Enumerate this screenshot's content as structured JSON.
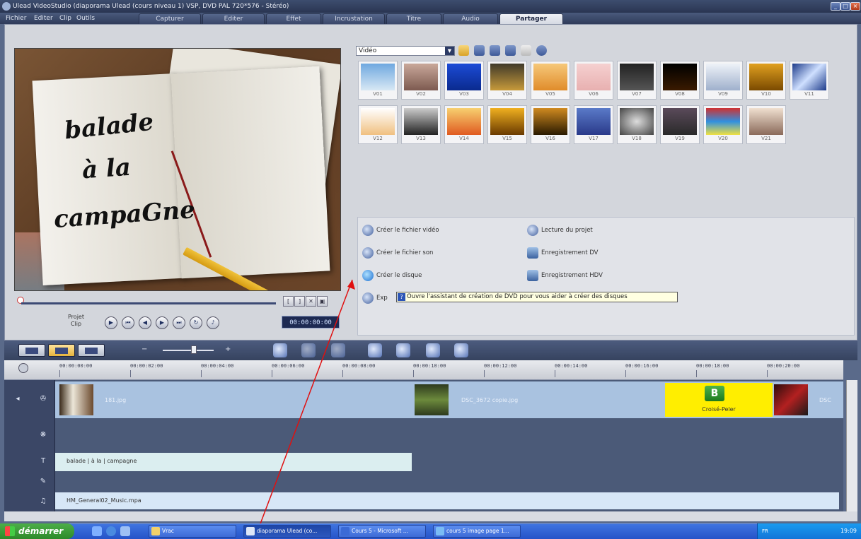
{
  "window": {
    "title": "Ulead VideoStudio (diaporama Ulead (cours niveau 1) VSP, DVD PAL 720*576 - Stéréo)"
  },
  "menu": [
    "Fichier",
    "Editer",
    "Clip",
    "Outils"
  ],
  "tabs": [
    "Capturer",
    "Editer",
    "Effet",
    "Incrustation",
    "Titre",
    "Audio",
    "Partager"
  ],
  "active_tab": "Partager",
  "preview": {
    "handwritten_text": [
      "balade",
      "à la",
      "campaGne"
    ],
    "mode_label_top": "Projet",
    "mode_label_bottom": "Clip",
    "timecode": "00:00:00:00"
  },
  "library": {
    "category": "Vidéo",
    "thumbnails": [
      "V01",
      "V02",
      "V03",
      "V04",
      "V05",
      "V06",
      "V07",
      "V08",
      "V09",
      "V10",
      "V11",
      "V12",
      "V13",
      "V14",
      "V15",
      "V16",
      "V17",
      "V18",
      "V19",
      "V20",
      "V21"
    ]
  },
  "share_options": [
    {
      "label": "Créer le fichier vidéo",
      "icon": "film-reel-icon"
    },
    {
      "label": "Lecture du projet",
      "icon": "play-project-icon"
    },
    {
      "label": "Créer le fichier son",
      "icon": "sound-file-icon"
    },
    {
      "label": "Enregistrement DV",
      "icon": "dv-camera-icon"
    },
    {
      "label": "Créer le disque",
      "icon": "disc-icon"
    },
    {
      "label": "Enregistrement HDV",
      "icon": "hdv-camera-icon"
    },
    {
      "label": "Exp",
      "icon": "export-icon"
    }
  ],
  "tooltip": "Ouvre l'assistant de création de DVD pour vous aider à créer des disques",
  "ruler_ticks": [
    "00:00:00:00",
    "00:00:02:00",
    "00:00:04:00",
    "00:00:06:00",
    "00:00:08:00",
    "00:00:10:00",
    "00:00:12:00",
    "00:00:14:00",
    "00:00:16:00",
    "00:00:18:00",
    "00:00:20:00"
  ],
  "timeline": {
    "video_clips": [
      "181.jpg",
      "DSC_3672 copie.jpg",
      "DSC"
    ],
    "transition_label": "Croisé-Peler",
    "title_clip": "balade | à la | campagne",
    "music_clip": "HM_General02_Music.mpa"
  },
  "taskbar": {
    "start_label": "démarrer",
    "items": [
      "Vrac",
      "diaporama Ulead (co...",
      "Cours 5 - Microsoft ...",
      "cours 5 image page 1..."
    ],
    "lang": "FR",
    "clock": "19:09"
  }
}
